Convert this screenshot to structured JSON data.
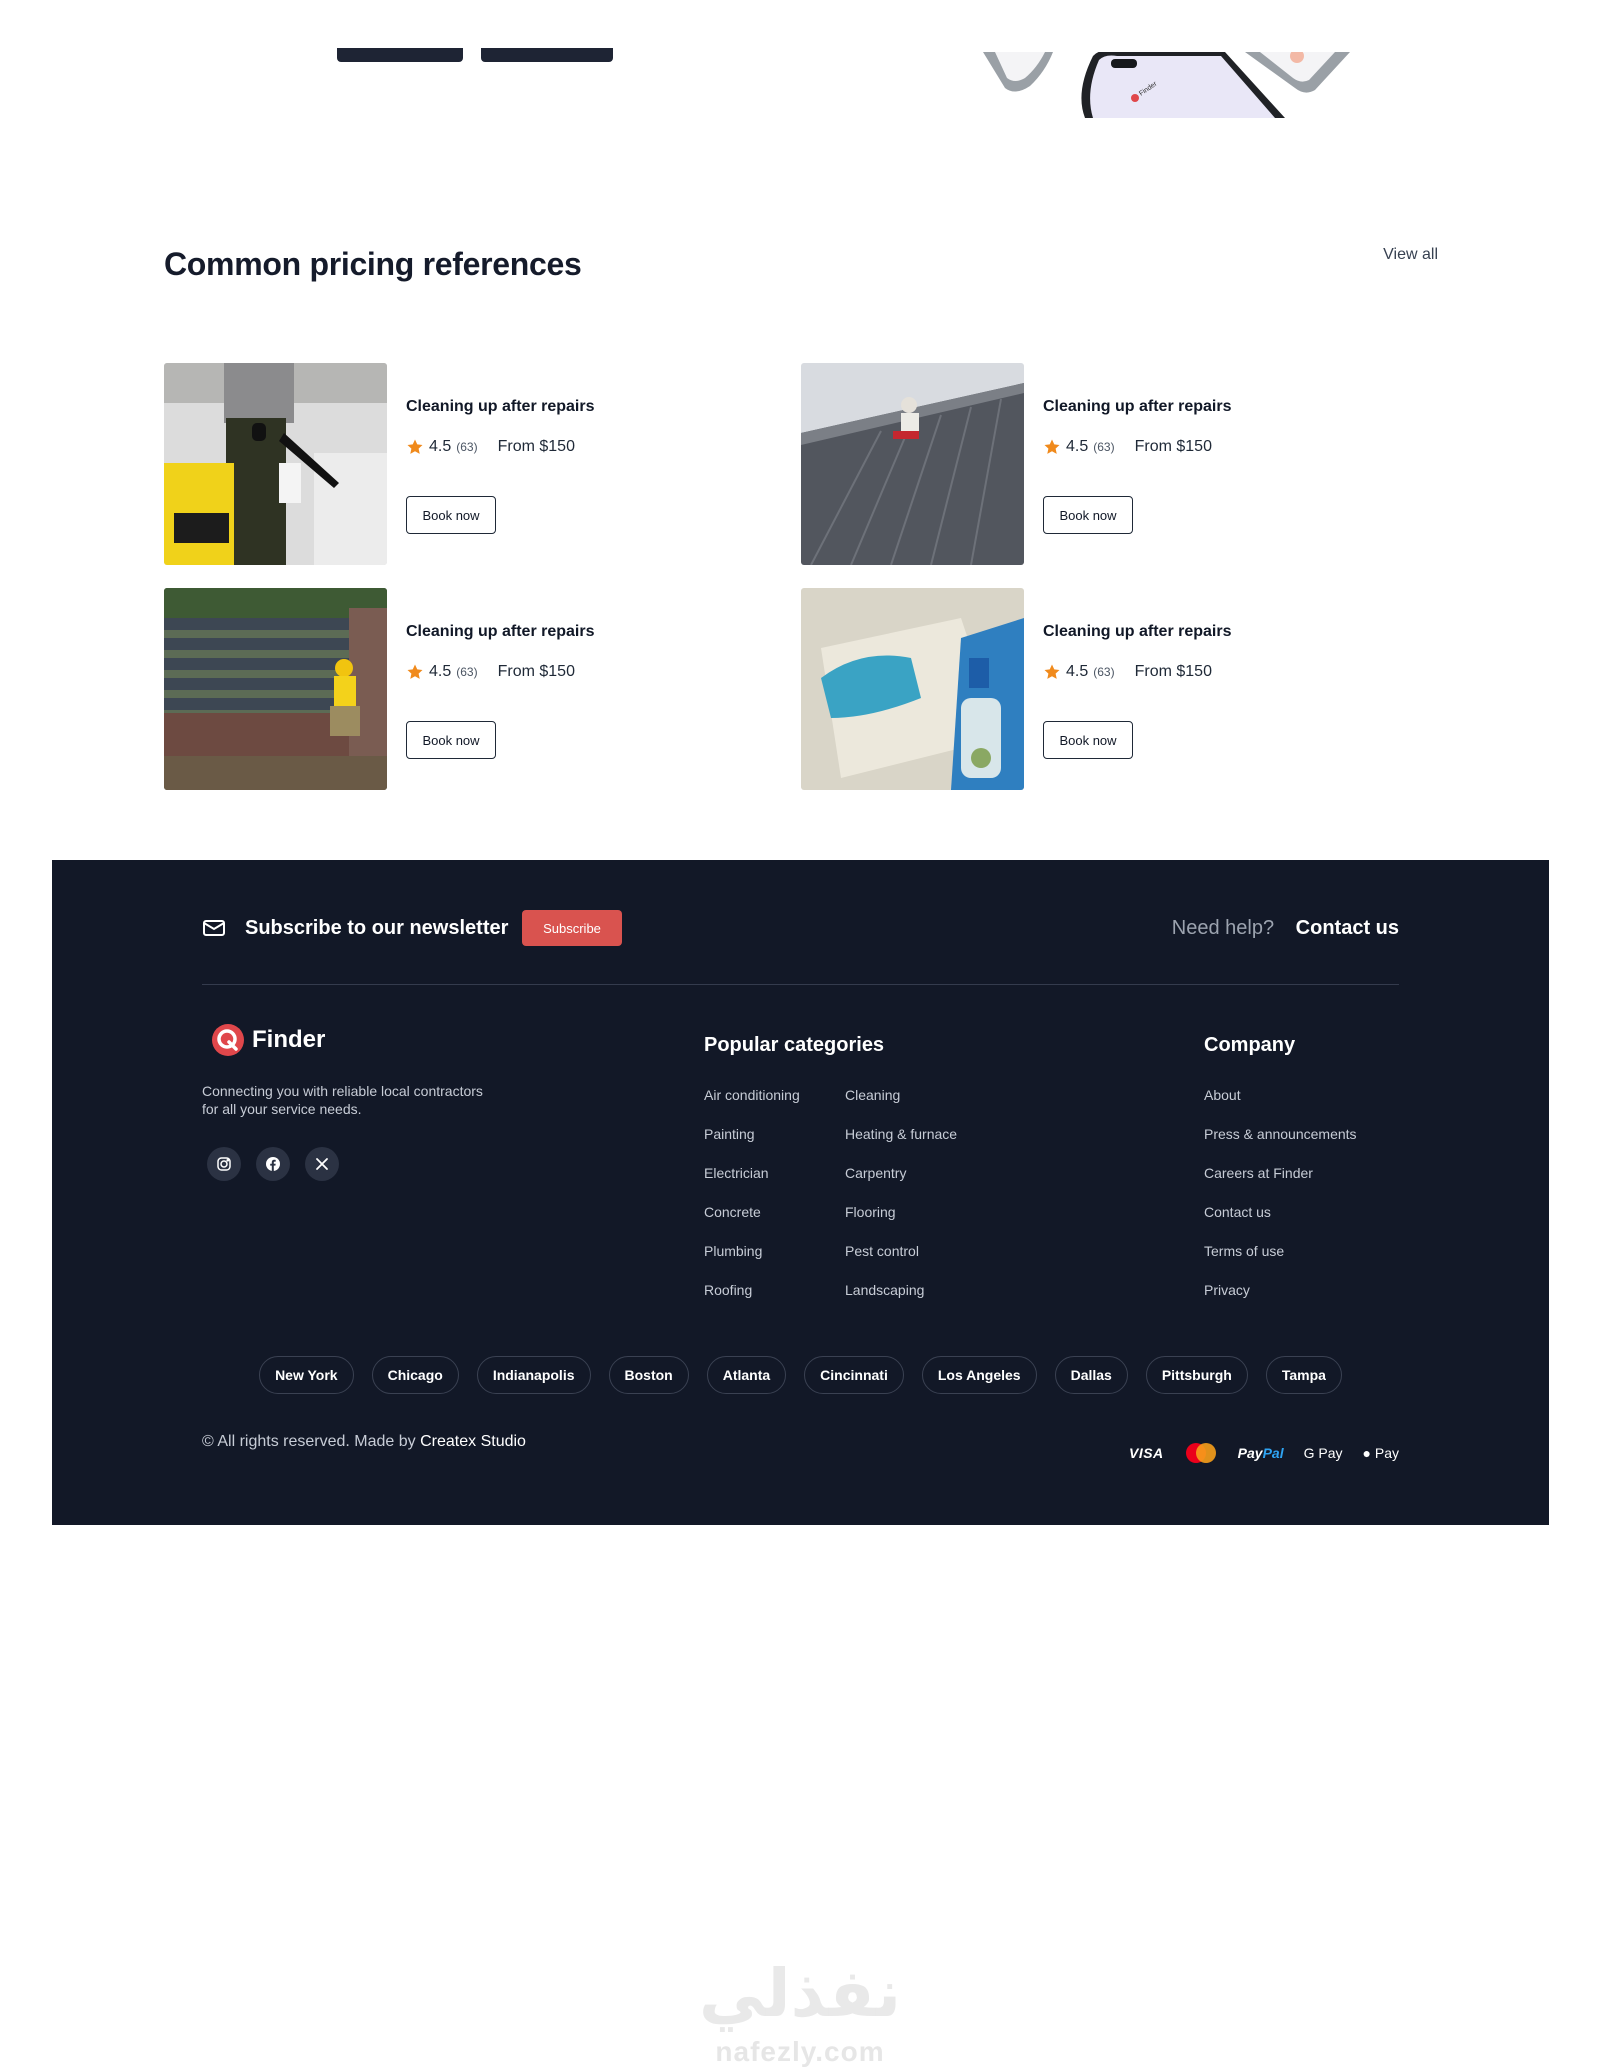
{
  "pricing": {
    "title": "Common pricing references",
    "view_all": "View all",
    "cards": [
      {
        "title": "Cleaning up after repairs",
        "rating": "4.5",
        "count": "(63)",
        "price": "From $150",
        "cta": "Book now"
      },
      {
        "title": "Cleaning up after repairs",
        "rating": "4.5",
        "count": "(63)",
        "price": "From $150",
        "cta": "Book now"
      },
      {
        "title": "Cleaning up after repairs",
        "rating": "4.5",
        "count": "(63)",
        "price": "From $150",
        "cta": "Book now"
      },
      {
        "title": "Cleaning up after repairs",
        "rating": "4.5",
        "count": "(63)",
        "price": "From $150",
        "cta": "Book now"
      }
    ]
  },
  "footer": {
    "newsletter_title": "Subscribe to our newsletter",
    "subscribe_label": "Subscribe",
    "help_text": "Need help?",
    "contact_label": "Contact us",
    "brand_name": "Finder",
    "tagline": "Connecting you with reliable local contractors for all your service needs.",
    "socials": [
      "instagram-icon",
      "facebook-icon",
      "x-icon"
    ],
    "popular_title": "Popular categories",
    "popular_col1": [
      "Air conditioning",
      "Painting",
      "Electrician",
      "Concrete",
      "Plumbing",
      "Roofing"
    ],
    "popular_col2": [
      "Cleaning",
      "Heating & furnace",
      "Carpentry",
      "Flooring",
      "Pest control",
      "Landscaping"
    ],
    "company_title": "Company",
    "company_links": [
      "About",
      "Press & announcements",
      "Careers at Finder",
      "Contact us",
      "Terms of use",
      "Privacy"
    ],
    "cities": [
      "New York",
      "Chicago",
      "Indianapolis",
      "Boston",
      "Atlanta",
      "Cincinnati",
      "Los Angeles",
      "Dallas",
      "Pittsburgh",
      "Tampa"
    ],
    "copyright_prefix": "© All rights reserved. Made by",
    "studio": "Createx Studio",
    "payments": {
      "visa": "VISA",
      "paypal_a": "Pay",
      "paypal_b": "Pal",
      "gpay": "G Pay",
      "applepay": " Pay"
    },
    "colors": {
      "background": "#121827",
      "accent": "#d9534f"
    }
  },
  "watermark": {
    "arabic": "نفذلي",
    "latin": "nafezly.com"
  },
  "phone_mockup_text": "Finder"
}
